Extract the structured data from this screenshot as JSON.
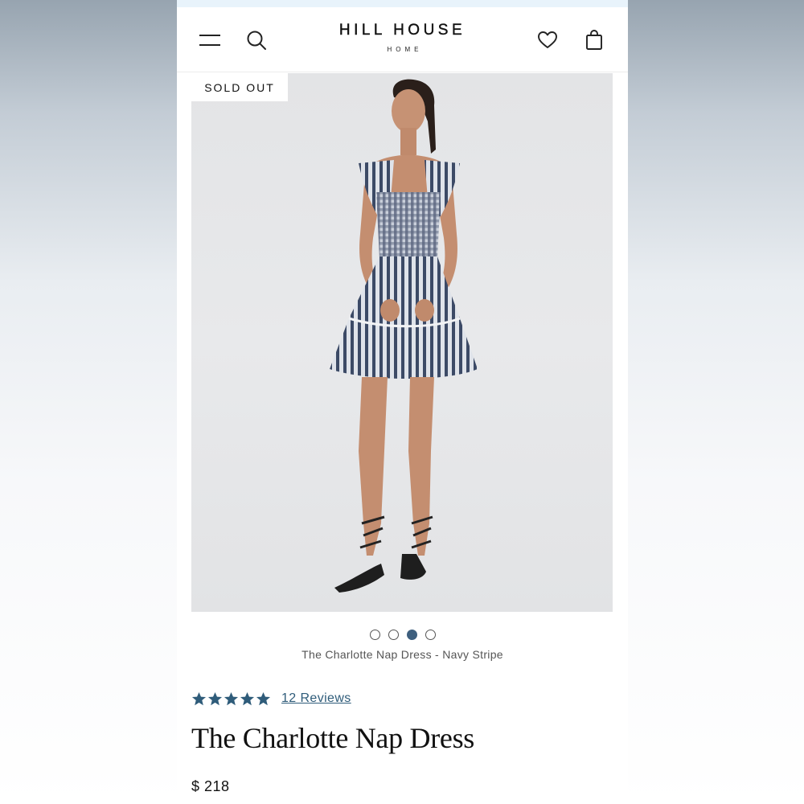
{
  "header": {
    "brand_name": "HILL HOUSE",
    "brand_sub": "HOME",
    "icons": [
      "menu-icon",
      "search-icon",
      "heart-icon",
      "shopping-bag-icon"
    ]
  },
  "product": {
    "badge": "SOLD OUT",
    "image_caption": "The Charlotte Nap Dress - Navy Stripe",
    "carousel": {
      "total": 4,
      "active": 3
    },
    "rating": {
      "stars": 5,
      "reviews_label": "12 Reviews"
    },
    "title": "The Charlotte Nap Dress",
    "price": "$ 218"
  },
  "colors": {
    "accent": "#2f5c7a",
    "active_dot": "#3e5f7e",
    "top_strip": "#e8f3fb"
  }
}
